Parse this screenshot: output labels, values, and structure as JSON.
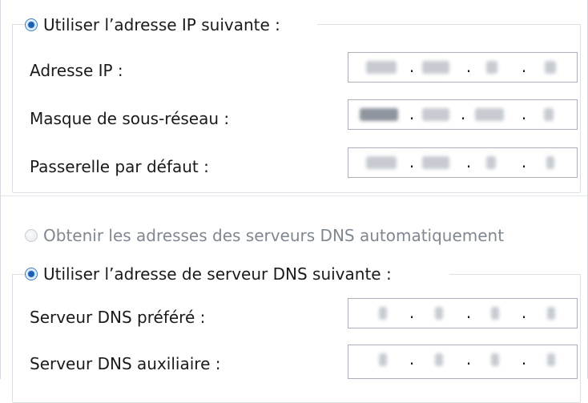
{
  "ip_section": {
    "radio_label": "Utiliser l’adresse IP suivante :",
    "selected": true,
    "fields": [
      {
        "label": "Adresse IP :",
        "value": "192.168.1.2"
      },
      {
        "label": "Masque de sous-réseau :",
        "value": "255.255.255.0"
      },
      {
        "label": "Passerelle par défaut :",
        "value": "192.168.2.1"
      }
    ]
  },
  "dns_section": {
    "auto_radio_label": "Obtenir les adresses des serveurs DNS automatiquement",
    "auto_selected": false,
    "manual_radio_label": "Utiliser l’adresse de serveur DNS suivante :",
    "manual_selected": true,
    "fields": [
      {
        "label": "Serveur DNS préféré :",
        "value": "8.8.8.8"
      },
      {
        "label": "Serveur DNS auxiliaire :",
        "value": "8.8.4.4"
      }
    ]
  },
  "ip_field_separator": ".",
  "colors": {
    "radio_selected": "#1a5fb0",
    "field_border": "#abb0b8",
    "disabled_text": "#7f8790"
  }
}
